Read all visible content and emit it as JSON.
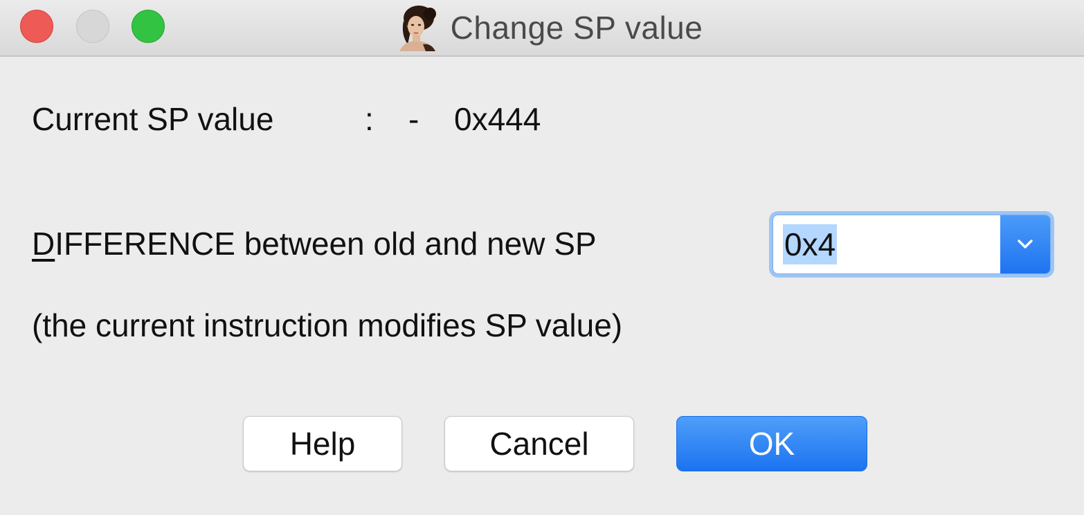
{
  "window": {
    "title": "Change SP value",
    "app_icon": "portrait-icon"
  },
  "current": {
    "label": "Current SP value",
    "colon": ":",
    "dash": "-",
    "value": "0x444"
  },
  "difference": {
    "mnemonic": "D",
    "label_rest": "IFFERENCE between old and new SP",
    "value": "0x4"
  },
  "note": "(the current instruction modifies SP value)",
  "buttons": {
    "help": "Help",
    "cancel": "Cancel",
    "ok": "OK"
  },
  "colors": {
    "accent": "#1f74f0",
    "selection": "#b3d7ff",
    "close": "#ee5a55",
    "minimize_disabled": "#d7d7d7",
    "maximize": "#32c342"
  }
}
